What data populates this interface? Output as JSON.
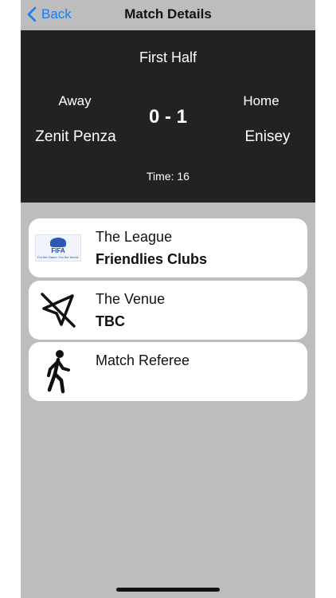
{
  "navbar": {
    "back_label": "Back",
    "title": "Match Details"
  },
  "match": {
    "period": "First Half",
    "away_label": "Away",
    "home_label": "Home",
    "away_team": "Zenit Penza",
    "home_team": "Enisey",
    "score": "0 - 1",
    "time": "Time: 16"
  },
  "cards": {
    "league": {
      "title": "The League",
      "value": "Friendlies Clubs",
      "logo_text": "FIFA",
      "logo_sub": "For the Game. For the World."
    },
    "venue": {
      "title": "The Venue",
      "value": "TBC"
    },
    "referee": {
      "title": "Match Referee",
      "value": ""
    }
  },
  "colors": {
    "accent": "#1a7cf5",
    "panel": "#222222",
    "background": "#bdbdbd",
    "card": "#ffffff"
  },
  "icons": {
    "back": "chevron-left-icon",
    "league": "fifa-logo",
    "venue": "location-slash-icon",
    "referee": "walking-person-icon"
  }
}
